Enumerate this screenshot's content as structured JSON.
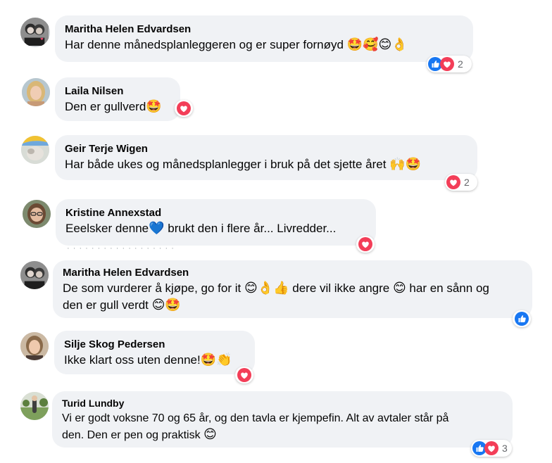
{
  "comments": [
    {
      "author": "Maritha Helen Edvardsen",
      "text": "Har denne månedsplanleggeren og er super fornøyd",
      "emojis": "🤩🥰😊👌",
      "reactions": [
        "like",
        "love"
      ],
      "reaction_count": "2",
      "avatar": "couple-photo"
    },
    {
      "author": "Laila Nilsen",
      "text": "Den er gullverd",
      "emojis": "🤩",
      "reactions": [
        "love"
      ],
      "reaction_count": "",
      "avatar": "woman-blonde"
    },
    {
      "author": "Geir Terje Wigen",
      "text": "Har både ukes og månedsplanlegger i bruk på det sjette året",
      "emojis": "🙌🤩",
      "reactions": [
        "love"
      ],
      "reaction_count": "2",
      "avatar": "outdoor-photo"
    },
    {
      "author": "Kristine Annexstad",
      "text_before": "Eeelsker denne",
      "mid_emoji": "💙",
      "text_after": " brukt den i flere år... Livredder...",
      "reactions": [
        "love"
      ],
      "reaction_count": "",
      "avatar": "woman-glasses"
    },
    {
      "author": "Maritha Helen Edvardsen",
      "line1_a": "De som vurderer å kjøpe, go for it ",
      "line1_emojis": "😊👌👍",
      "line1_b": " dere vil ikke angre ",
      "line1_emoji2": "😊",
      "line1_c": " har en sånn og",
      "line2": "den er gull verdt ",
      "line2_emojis": "😊🤩",
      "reactions": [
        "like"
      ],
      "reaction_count": "",
      "avatar": "couple-photo"
    },
    {
      "author": "Silje Skog Pedersen",
      "text": "Ikke klart oss uten denne!",
      "emojis": "🤩👏",
      "reactions": [
        "love"
      ],
      "reaction_count": "",
      "avatar": "woman-portrait"
    },
    {
      "author": "Turid Lundby",
      "line1": "Vi er godt voksne 70 og 65 år, og den tavla er kjempefin. Alt av avtaler står på",
      "line2": "den. Den er pen og praktisk ",
      "line2_emojis": "😊",
      "reactions": [
        "like",
        "love"
      ],
      "reaction_count": "3",
      "avatar": "garden-photo"
    }
  ],
  "colors": {
    "bubble": "#f0f2f5",
    "like": "#1877f2",
    "love": "#f33e58",
    "count": "#65676b"
  }
}
